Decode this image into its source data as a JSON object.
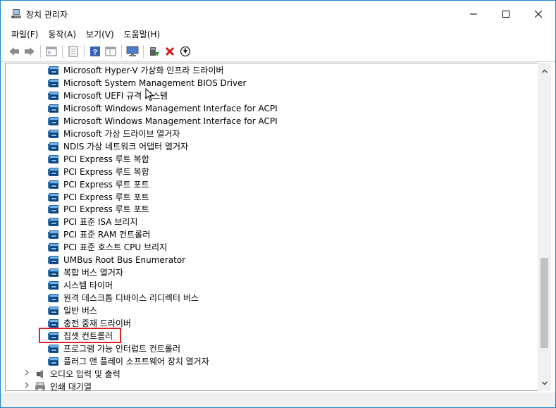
{
  "window": {
    "title": "장치 관리자",
    "minimize": "—",
    "maximize": "☐",
    "close": "✕"
  },
  "menu": [
    "파일(F)",
    "동작(A)",
    "보기(V)",
    "도움말(H)"
  ],
  "toolbar": {
    "buttons": [
      "back-icon",
      "forward-icon",
      "properties-pane-icon",
      "list-icon",
      "help-icon",
      "details-icon",
      "monitor-icon",
      "update-driver-icon",
      "uninstall-icon",
      "scan-icon"
    ]
  },
  "tree": {
    "devices": [
      "Microsoft Hyper-V 가상화 인프라 드라이버",
      "Microsoft System Management BIOS Driver",
      "Microsoft UEFI 규격 시스템",
      "Microsoft Windows Management Interface for ACPI",
      "Microsoft Windows Management Interface for ACPI",
      "Microsoft 가상 드라이브 열거자",
      "NDIS 가상 네트워크 어댑터 열거자",
      "PCI Express 루트 복합",
      "PCI Express 루트 복합",
      "PCI Express 루트 포트",
      "PCI Express 루트 포트",
      "PCI Express 루트 포트",
      "PCI 표준 ISA 브리지",
      "PCI 표준 RAM 컨트롤러",
      "PCI 표준 호스트 CPU 브리지",
      "UMBus Root Bus Enumerator",
      "복합 버스 열거자",
      "시스템 타이머",
      "원격 데스크톱 디바이스 리디렉터 버스",
      "일반 버스",
      "충전 중재 드라이버",
      "칩셋 컨트롤러",
      "프로그램 가능 인터럽트 컨트롤러",
      "플러그 앤 플레이 소프트웨어 장치 열거자"
    ],
    "categories": [
      "오디오 입력 및 출력",
      "인쇄 대기열"
    ],
    "selected": "칩셋 컨트롤러"
  },
  "colors": {
    "highlight_border": "#e02020",
    "window_border": "#1883d7"
  }
}
